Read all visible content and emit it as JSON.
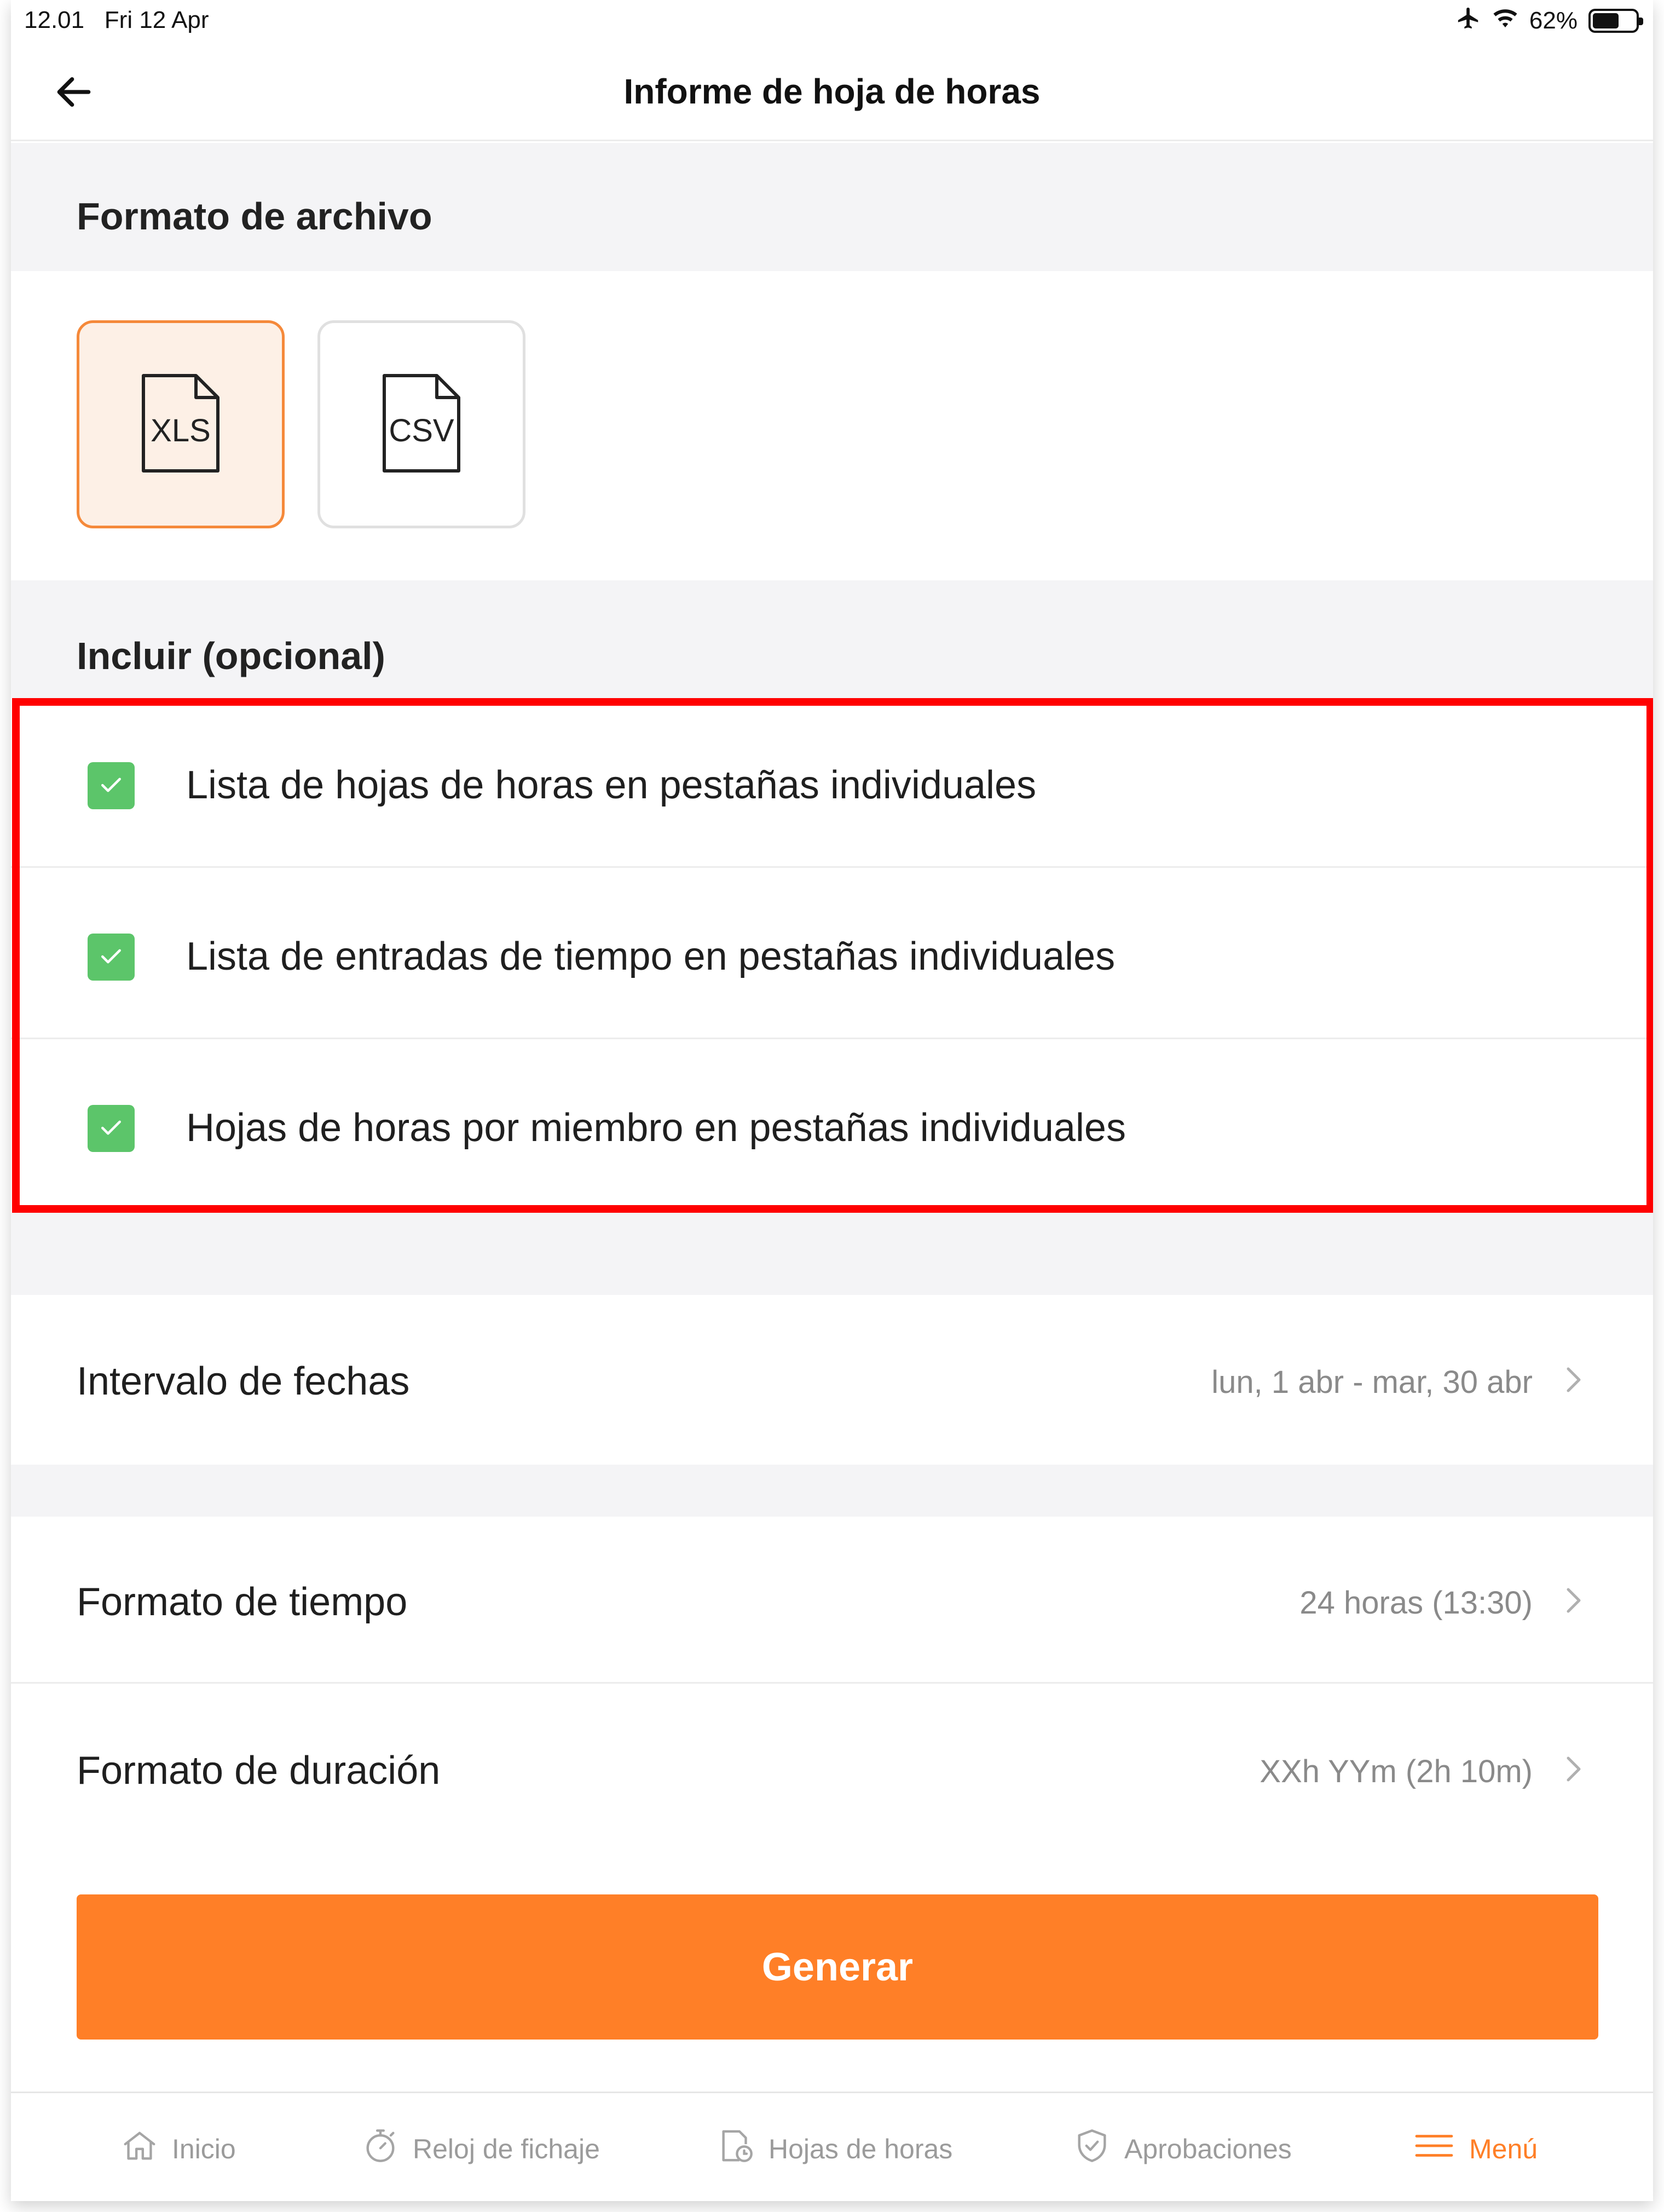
{
  "status_bar": {
    "time": "12.01",
    "date": "Fri 12 Apr",
    "battery": "62%",
    "battery_level": 0.62,
    "icons": [
      "airplane-icon",
      "wifi-icon",
      "battery-icon"
    ]
  },
  "nav": {
    "title": "Informe de hoja de horas",
    "back_icon": "back-arrow-icon"
  },
  "file_format": {
    "header": "Formato de archivo",
    "options": [
      {
        "label": "XLS",
        "selected": true
      },
      {
        "label": "CSV",
        "selected": false
      }
    ]
  },
  "include": {
    "header": "Incluir (opcional)",
    "items": [
      {
        "label": "Lista de hojas de horas en pestañas individuales",
        "checked": true
      },
      {
        "label": "Lista de entradas de tiempo en pestañas individuales",
        "checked": true
      },
      {
        "label": "Hojas de horas por miembro en pestañas individuales",
        "checked": true
      }
    ]
  },
  "settings": {
    "date_range": {
      "label": "Intervalo de fechas",
      "value": "lun, 1 abr - mar, 30 abr"
    },
    "time_format": {
      "label": "Formato de tiempo",
      "value": "24 horas (13:30)"
    },
    "duration_format": {
      "label": "Formato de duración",
      "value": "XXh YYm (2h 10m)"
    }
  },
  "generate_label": "Generar",
  "tabbar": {
    "tabs": [
      {
        "label": "Inicio",
        "icon": "home-icon",
        "active": false
      },
      {
        "label": "Reloj de fichaje",
        "icon": "stopwatch-icon",
        "active": false
      },
      {
        "label": "Hojas de horas",
        "icon": "timesheet-icon",
        "active": false
      },
      {
        "label": "Aprobaciones",
        "icon": "shield-check-icon",
        "active": false
      },
      {
        "label": "Menú",
        "icon": "menu-icon",
        "active": true
      }
    ]
  },
  "colors": {
    "accent": "#ff7f27",
    "check": "#5cc56a",
    "highlight": "#ff0000",
    "selected_bg": "#fdf0e6",
    "selected_border": "#f5893a"
  }
}
